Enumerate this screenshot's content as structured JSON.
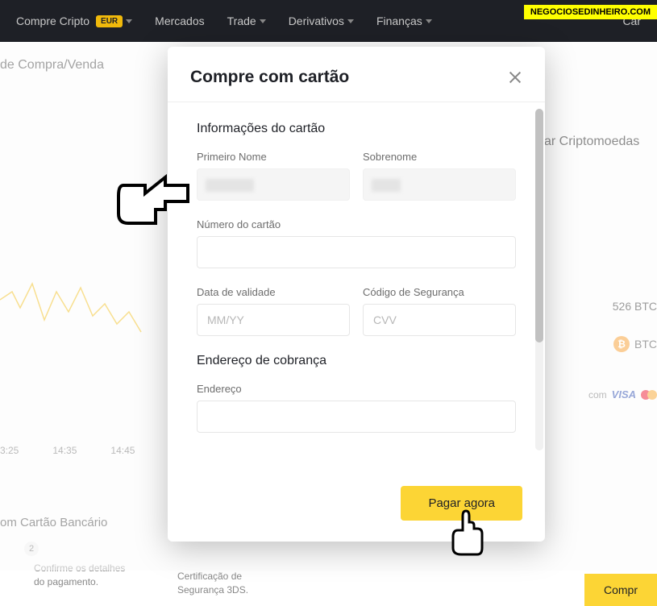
{
  "watermark": "NEGOCIOSEDINHEIRO.COM",
  "nav": {
    "buy_crypto": "Compre Cripto",
    "eur_badge": "EUR",
    "markets": "Mercados",
    "trade": "Trade",
    "derivatives": "Derivativos",
    "finance": "Finanças",
    "wallet_hint": "Car"
  },
  "bg": {
    "buy_sell_title": "de Compra/Venda",
    "time1": "3:25",
    "time2": "14:35",
    "time3": "14:45",
    "card_title": "om Cartão Bancário",
    "step_num": "2",
    "step_text1": "Confirme os detalhes",
    "step_text2": "do pagamento.",
    "step_text3": "Certificação de",
    "step_text4": "Segurança 3DS.",
    "right_title": "ar Criptomoedas",
    "btc_qty": "526 BTC",
    "btc_label": "BTC",
    "pay_domain": "com",
    "buy_btn": "Compr"
  },
  "modal": {
    "title": "Compre com cartão",
    "card_info": "Informações do cartão",
    "first_name_label": "Primeiro Nome",
    "last_name_label": "Sobrenome",
    "card_number_label": "Número do cartão",
    "expiry_label": "Data de validade",
    "expiry_placeholder": "MM/YY",
    "cvv_label": "Código de Segurança",
    "cvv_placeholder": "CVV",
    "billing_title": "Endereço de cobrança",
    "address_label": "Endereço",
    "pay_button": "Pagar agora"
  }
}
